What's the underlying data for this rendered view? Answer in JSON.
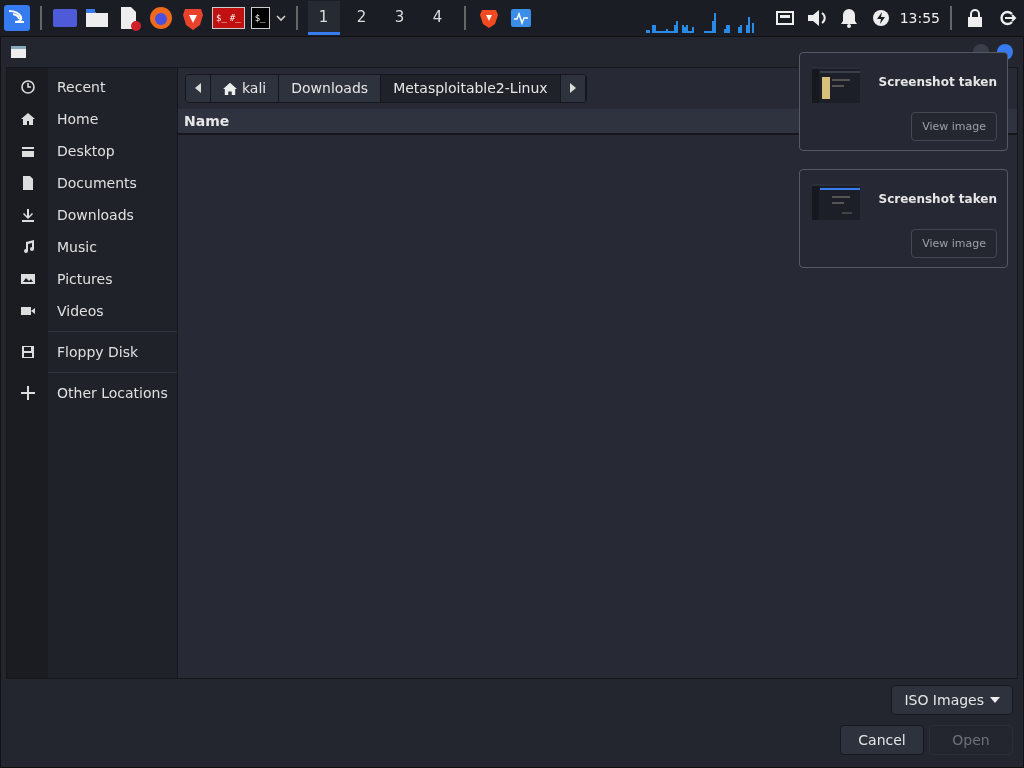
{
  "taskbar": {
    "root_terminal_text": [
      "$_",
      "#_"
    ],
    "terminal_text": "$_",
    "workspaces": [
      {
        "label": "1",
        "selected": true
      },
      {
        "label": "2",
        "selected": false
      },
      {
        "label": "3",
        "selected": false
      },
      {
        "label": "4",
        "selected": false
      }
    ],
    "clock": "13:55"
  },
  "dialog": {
    "sidebar": [
      {
        "items": [
          {
            "label": "Recent"
          },
          {
            "label": "Home"
          },
          {
            "label": "Desktop"
          },
          {
            "label": "Documents"
          },
          {
            "label": "Downloads"
          },
          {
            "label": "Music"
          },
          {
            "label": "Pictures"
          },
          {
            "label": "Videos"
          }
        ]
      },
      {
        "items": [
          {
            "label": "Floppy Disk"
          }
        ]
      },
      {
        "items": [
          {
            "label": "Other Locations"
          }
        ]
      }
    ],
    "path": [
      {
        "label": "kali",
        "kind": "home",
        "selected": false
      },
      {
        "label": "Downloads",
        "kind": "folder",
        "selected": false
      },
      {
        "label": "Metasploitable2-Linux",
        "kind": "folder",
        "selected": true
      }
    ],
    "columns": [
      "Name"
    ],
    "filter": "ISO Images",
    "buttons": [
      {
        "label": "Cancel",
        "disabled": false
      },
      {
        "label": "Open",
        "disabled": true
      }
    ]
  },
  "notifications": [
    {
      "title": "Screenshot taken",
      "action": "View image"
    },
    {
      "title": "Screenshot taken",
      "action": "View image"
    }
  ]
}
